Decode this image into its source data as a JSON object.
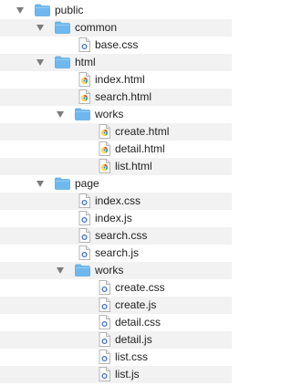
{
  "tree": [
    {
      "label": "public",
      "kind": "folder",
      "depth": 0,
      "expanded": true
    },
    {
      "label": "common",
      "kind": "folder",
      "depth": 1,
      "expanded": true
    },
    {
      "label": "base.css",
      "kind": "css",
      "depth": 2
    },
    {
      "label": "html",
      "kind": "folder",
      "depth": 1,
      "expanded": true
    },
    {
      "label": "index.html",
      "kind": "html",
      "depth": 2
    },
    {
      "label": "search.html",
      "kind": "html",
      "depth": 2
    },
    {
      "label": "works",
      "kind": "folder",
      "depth": 2,
      "expanded": true
    },
    {
      "label": "create.html",
      "kind": "html",
      "depth": 3
    },
    {
      "label": "detail.html",
      "kind": "html",
      "depth": 3
    },
    {
      "label": "list.html",
      "kind": "html",
      "depth": 3
    },
    {
      "label": "page",
      "kind": "folder",
      "depth": 1,
      "expanded": true
    },
    {
      "label": "index.css",
      "kind": "css",
      "depth": 2
    },
    {
      "label": "index.js",
      "kind": "js",
      "depth": 2
    },
    {
      "label": "search.css",
      "kind": "css",
      "depth": 2
    },
    {
      "label": "search.js",
      "kind": "js",
      "depth": 2
    },
    {
      "label": "works",
      "kind": "folder",
      "depth": 2,
      "expanded": true
    },
    {
      "label": "create.css",
      "kind": "css",
      "depth": 3
    },
    {
      "label": "create.js",
      "kind": "js",
      "depth": 3
    },
    {
      "label": "detail.css",
      "kind": "css",
      "depth": 3
    },
    {
      "label": "detail.js",
      "kind": "js",
      "depth": 3
    },
    {
      "label": "list.css",
      "kind": "css",
      "depth": 3
    },
    {
      "label": "list.js",
      "kind": "js",
      "depth": 3
    }
  ],
  "colors": {
    "folder": "#6fb8ef",
    "folder_tab": "#5aa6df",
    "row_alt": "#f2f2f2",
    "text": "#1e1e1e"
  },
  "icons": {
    "folder": "folder-icon",
    "css": "css-file-icon",
    "js": "js-file-icon",
    "html": "html-file-icon",
    "disclosure": "disclosure-triangle-icon"
  }
}
